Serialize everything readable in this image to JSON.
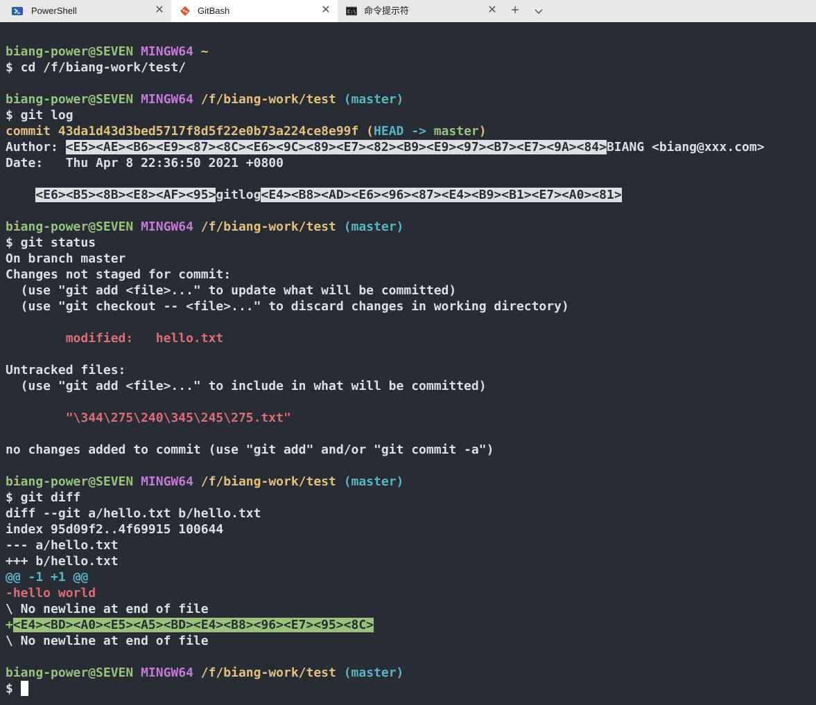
{
  "tabs": [
    {
      "label": "PowerShell",
      "icon": "powershell-icon"
    },
    {
      "label": "GitBash",
      "icon": "git-icon"
    },
    {
      "label": "命令提示符",
      "icon": "cmd-icon"
    }
  ],
  "colors": {
    "background": "#282c34",
    "green": "#98c379",
    "magenta": "#c678dd",
    "yellow": "#e5c07b",
    "cyan": "#56b6c2",
    "red": "#e06c75"
  },
  "terminal": {
    "user": "biang-power@SEVEN",
    "mingw": "MINGW64",
    "home_path": "~",
    "repo_path": "/f/biang-work/test",
    "branch": "(master)",
    "prompt": "$",
    "cmd_cd": "$ cd /f/biang-work/test/",
    "cmd_log": "$ git log",
    "commit_prefix": "commit 43da1d43d3bed5717f8d5f22e0b73a224ce8e99f (",
    "head_arrow": "HEAD -> ",
    "commit_branch": "master",
    "commit_close": ")",
    "author_label": "Author: ",
    "author_bytes": "<E5><AE><B6><E9><87><8C><E6><9C><89><E7><82><B9><E9><97><B7><E7><9A><84>",
    "author_rest": "BIANG <biang@xxx.com>",
    "date_line": "Date:   Thu Apr 8 22:36:50 2021 +0800",
    "msg_bytes_1": "<E6><B5><8B><E8><AF><95>",
    "msg_text": "gitlog",
    "msg_bytes_2": "<E4><B8><AD><E6><96><87><E4><B9><B1><E7><A0><81>",
    "cmd_status": "$ git status",
    "on_branch": "On branch master",
    "changes_not_staged": "Changes not staged for commit:",
    "hint_add": "  (use \"git add <file>...\" to update what will be committed)",
    "hint_checkout": "  (use \"git checkout -- <file>...\" to discard changes in working directory)",
    "modified_line": "        modified:   hello.txt",
    "untracked": "Untracked files:",
    "hint_include": "  (use \"git add <file>...\" to include in what will be committed)",
    "untracked_file": "        \"\\344\\275\\240\\345\\245\\275.txt\"",
    "no_changes": "no changes added to commit (use \"git add\" and/or \"git commit -a\")",
    "cmd_diff": "$ git diff",
    "diff_header": "diff --git a/hello.txt b/hello.txt",
    "diff_index": "index 95d09f2..4f69915 100644",
    "diff_minus_file": "--- a/hello.txt",
    "diff_plus_file": "+++ b/hello.txt",
    "hunk": "@@ -1 +1 @@",
    "removed_line": "-hello world",
    "no_newline": "\\ No newline at end of file",
    "added_plus": "+",
    "added_bytes": "<E4><BD><A0><E5><A5><BD><E4><B8><96><E7><95><8C>"
  }
}
